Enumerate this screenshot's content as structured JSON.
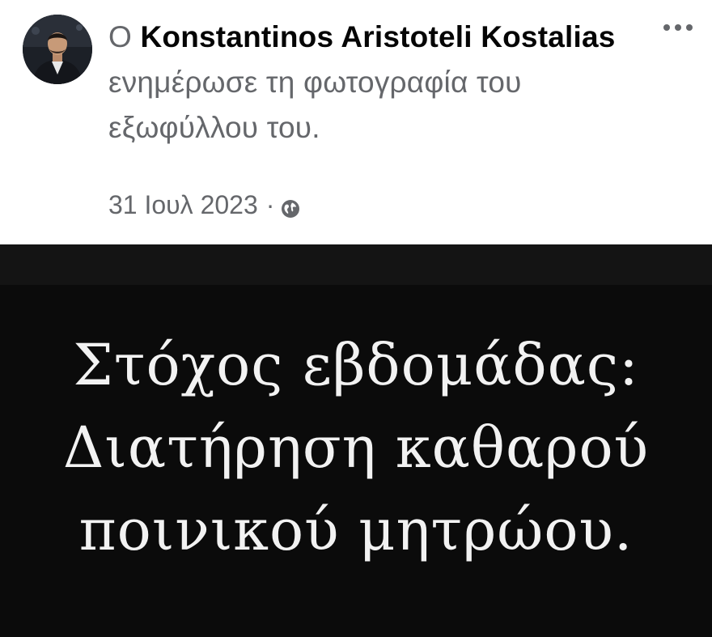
{
  "post": {
    "prefix": "Ο",
    "author": "Konstantinos Aristoteli Kostalias",
    "action": "ενημέρωσε τη φωτογραφία του εξωφύλλου του.",
    "date": "31 Ιουλ 2023",
    "separator": "·",
    "privacy_icon": "globe-icon",
    "more_icon": "more-options-icon"
  },
  "cover_photo": {
    "lines": [
      "Στόχος εβδομάδας:",
      "Διατήρηση καθαρού",
      "ποινικού μητρώου."
    ]
  },
  "colors": {
    "secondary_text": "#65676b",
    "primary_text": "#050505",
    "photo_background": "#0b0b0b",
    "photo_text": "#f2f2f2"
  }
}
